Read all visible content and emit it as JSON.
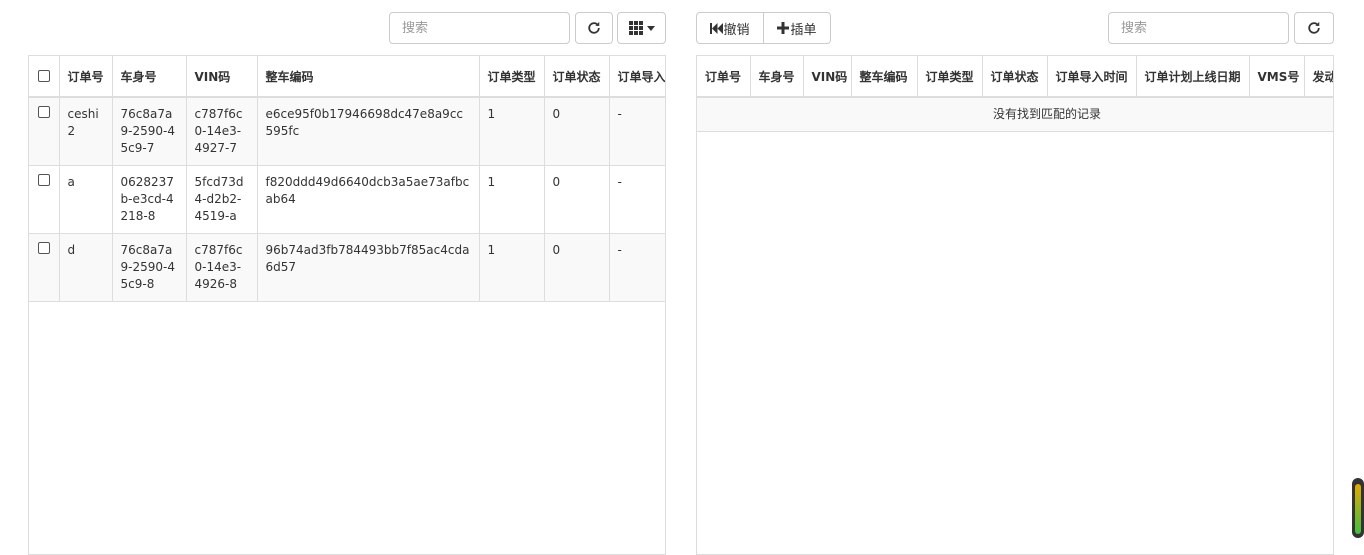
{
  "left": {
    "search_placeholder": "搜索",
    "toolbar": {
      "refresh_icon": "refresh-icon",
      "columns_icon": "grid-icon",
      "dropdown_icon": "caret-down-icon"
    },
    "columns": [
      "订单号",
      "车身号",
      "VIN码",
      "整车编码",
      "订单类型",
      "订单状态",
      "订单导入"
    ],
    "rows": [
      [
        "ceshi2",
        "76c8a7a9-2590-45c9-7",
        "c787f6c0-14e3-4927-7",
        "e6ce95f0b17946698dc47e8a9cc595fc",
        "1",
        "0",
        "-"
      ],
      [
        "a",
        "0628237b-e3cd-4218-8",
        "5fcd73d4-d2b2-4519-a",
        "f820ddd49d6640dcb3a5ae73afbcab64",
        "1",
        "0",
        "-"
      ],
      [
        "d",
        "76c8a7a9-2590-45c9-8",
        "c787f6c0-14e3-4926-8",
        "96b74ad3fb784493bb7f85ac4cda6d57",
        "1",
        "0",
        "-"
      ]
    ]
  },
  "right": {
    "undo_label": "撤销",
    "insert_label": "插单",
    "search_placeholder": "搜索",
    "columns": [
      "订单号",
      "车身号",
      "VIN码",
      "整车编码",
      "订单类型",
      "订单状态",
      "订单导入时间",
      "订单计划上线日期",
      "VMS号",
      "发动"
    ],
    "empty_message": "没有找到匹配的记录"
  }
}
